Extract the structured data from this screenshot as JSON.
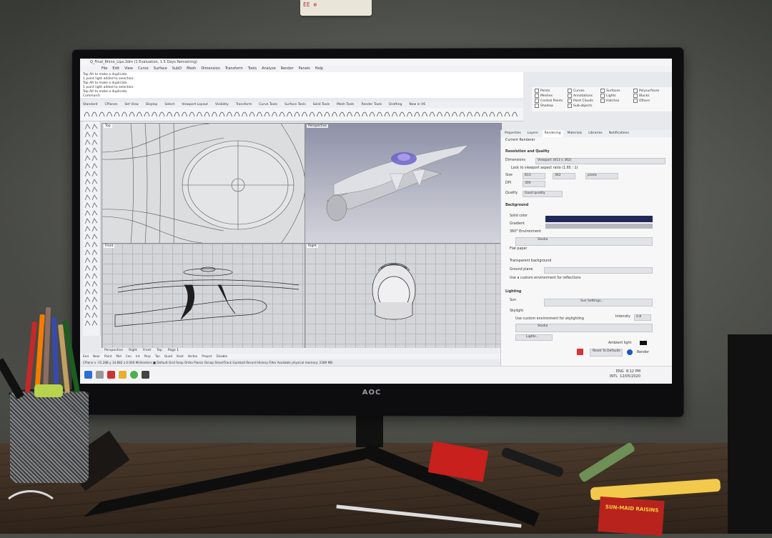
{
  "photo": {
    "monitor_brand": "AOC",
    "sticky_note": "EE ⊕"
  },
  "app": {
    "window_title": "Q_Final_Rhino_Lips.3dm (1 Evaluation, 1 5 Days Remaining)",
    "menu": [
      "File",
      "Edit",
      "View",
      "Curve",
      "Surface",
      "SubD",
      "Mesh",
      "Dimension",
      "Transform",
      "Tools",
      "Analyze",
      "Render",
      "Panels",
      "Help"
    ],
    "command_history": [
      "Tap Alt to make a duplicate.",
      "1 point light added to selection.",
      "Tap Alt to make a duplicate.",
      "1 point light added to selection.",
      "Tap Alt to make a duplicate.",
      "Command:"
    ],
    "toolbar_tabs": [
      "Standard",
      "CPlanes",
      "Set View",
      "Display",
      "Select",
      "Viewport Layout",
      "Visibility",
      "Transform",
      "Curve Tools",
      "Surface Tools",
      "Solid Tools",
      "Mesh Tools",
      "Render Tools",
      "Drafting",
      "New in V6"
    ],
    "viewports": {
      "top_label": "Top",
      "perspective_label": "Perspective",
      "front_label": "Front",
      "right_label": "Right"
    },
    "viewport_tabs": [
      "Perspective",
      "Right",
      "Front",
      "Top",
      "Page 1"
    ],
    "osnaps_bottom": [
      "End",
      "Near",
      "Point",
      "Mid",
      "Cen",
      "Int",
      "Perp",
      "Tan",
      "Quad",
      "Knot",
      "Vertex",
      "Project",
      "Disable"
    ],
    "status_bar": "CPlane   x -15.288   y 14.882   z 0.000   Millimeters   ■ Default   Grid Snap   Ortho   Planar   Osnap   SmartTrack   Gumball   Record History   Filter   Available physical memory: 2389 MB",
    "object_filter": {
      "col1": [
        "Points",
        "Meshes",
        "Control Points",
        "Shadow"
      ],
      "col2": [
        "Curves",
        "Annotations",
        "Point Clouds",
        "Sub-objects"
      ],
      "col3": [
        "Surfaces",
        "Lights",
        "Hatches"
      ],
      "col4": [
        "Polysurfaces",
        "Blocks",
        "Others"
      ]
    },
    "panel": {
      "tabs": [
        "Properties",
        "Layers",
        "Rendering",
        "Materials",
        "Libraries",
        "Notifications"
      ],
      "current_renderer": "Current Renderer",
      "section_resolution": "Resolution and Quality",
      "dimensions_label": "Dimensions",
      "dimensions_value": "Viewport (813 x 362)",
      "lock_label": "Lock to viewport aspect ratio (1.65 : 1)",
      "size_label": "Size",
      "size_w": "813",
      "size_h": "362",
      "units": "pixels",
      "dpi_label": "DPI",
      "dpi_value": "300",
      "quality_label": "Quality",
      "quality_value": "Good quality",
      "section_background": "Background",
      "solid_color": "Solid color",
      "gradient": "Gradient",
      "environment_360": "360° Environment",
      "studio": "Studio",
      "flat_paper": "Flat paper",
      "transparent_bg": "Transparent background",
      "ground_plane": "Ground plane",
      "use_env": "Use a custom environment for reflections",
      "section_lighting": "Lighting",
      "sun": "Sun",
      "sun_settings": "Sun Settings...",
      "skylight": "Skylight",
      "intensity_label": "Intensity",
      "intensity_value": "0.8",
      "custom_env": "Use custom environment for skylighting",
      "studio2": "Studio",
      "lights": "Lights...",
      "ambient_light": "Ambient light",
      "reset_label": "Reset To Defaults",
      "render_label": "Render"
    },
    "taskbar": {
      "lang": "ENG",
      "lang2": "INTL",
      "time": "8:12 PM",
      "date": "12/05/2020"
    }
  },
  "colors": {
    "background_navy": "#23285a",
    "gradient_gray": "#b7b8bd",
    "raisin_box": "#c8201c"
  },
  "desk_items": {
    "raisin_box_text": "SUN-MAID RAISINS"
  }
}
